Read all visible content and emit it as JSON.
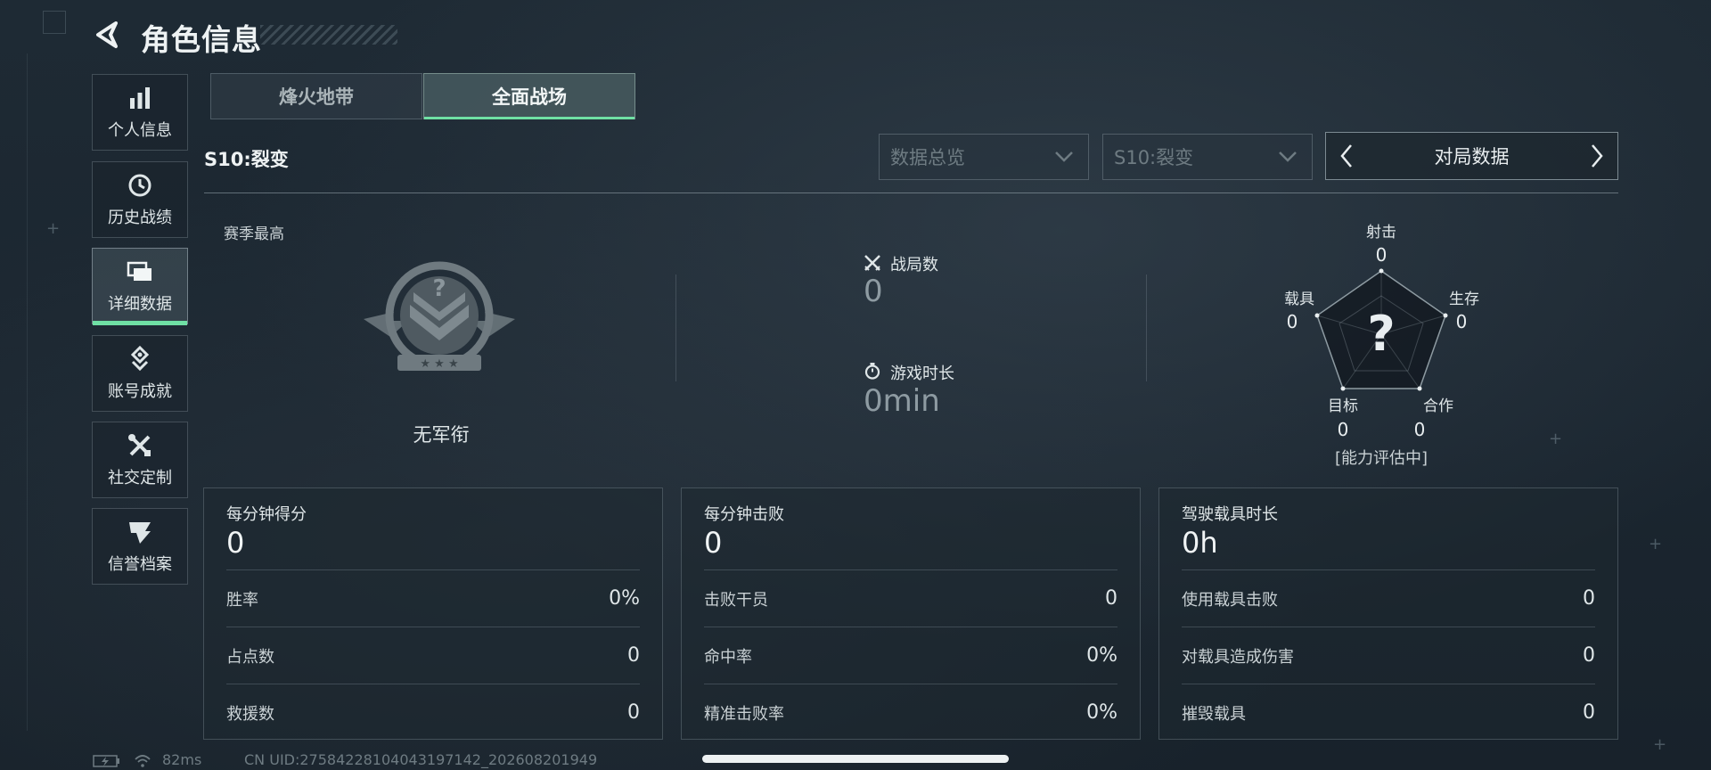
{
  "header": {
    "title": "角色信息"
  },
  "sidebar": {
    "items": [
      {
        "label": "个人信息",
        "icon": "bar-chart-icon",
        "active": false
      },
      {
        "label": "历史战绩",
        "icon": "history-icon",
        "active": false
      },
      {
        "label": "详细数据",
        "icon": "folder-icon",
        "active": true
      },
      {
        "label": "账号成就",
        "icon": "achievement-icon",
        "active": false
      },
      {
        "label": "社交定制",
        "icon": "tools-icon",
        "active": false
      },
      {
        "label": "信誉档案",
        "icon": "shield-icon",
        "active": false
      }
    ]
  },
  "mode_tabs": [
    {
      "label": "烽火地带",
      "active": false
    },
    {
      "label": "全面战场",
      "active": true
    }
  ],
  "season": {
    "label": "S10:裂变"
  },
  "filters": {
    "overview": "数据总览",
    "season": "S10:裂变",
    "data_type": "对局数据"
  },
  "season_best": {
    "title": "赛季最高",
    "rank_name": "无军衔"
  },
  "stats": {
    "matches": {
      "label": "战局数",
      "value": "0"
    },
    "playtime": {
      "label": "游戏时长",
      "value": "0min"
    }
  },
  "radar": {
    "shooting": {
      "label": "射击",
      "value": "0"
    },
    "survival": {
      "label": "生存",
      "value": "0"
    },
    "cooperation": {
      "label": "合作",
      "value": "0"
    },
    "objective": {
      "label": "目标",
      "value": "0"
    },
    "vehicle": {
      "label": "载具",
      "value": "0"
    },
    "center_mark": "?",
    "status": "[能力评估中]"
  },
  "panels": [
    {
      "title": "每分钟得分",
      "value": "0",
      "rows": [
        {
          "label": "胜率",
          "value": "0%"
        },
        {
          "label": "占点数",
          "value": "0"
        },
        {
          "label": "救援数",
          "value": "0"
        }
      ]
    },
    {
      "title": "每分钟击败",
      "value": "0",
      "rows": [
        {
          "label": "击败干员",
          "value": "0"
        },
        {
          "label": "命中率",
          "value": "0%"
        },
        {
          "label": "精准击败率",
          "value": "0%"
        }
      ]
    },
    {
      "title": "驾驶载具时长",
      "value": "0h",
      "rows": [
        {
          "label": "使用载具击败",
          "value": "0"
        },
        {
          "label": "对载具造成伤害",
          "value": "0"
        },
        {
          "label": "摧毁载具",
          "value": "0"
        }
      ]
    }
  ],
  "status_bar": {
    "ping": "82ms",
    "uid": "CN UID:27584228104043197142_202608201949"
  },
  "colors": {
    "accent": "#6fe0a4",
    "background": "#1d2933"
  }
}
